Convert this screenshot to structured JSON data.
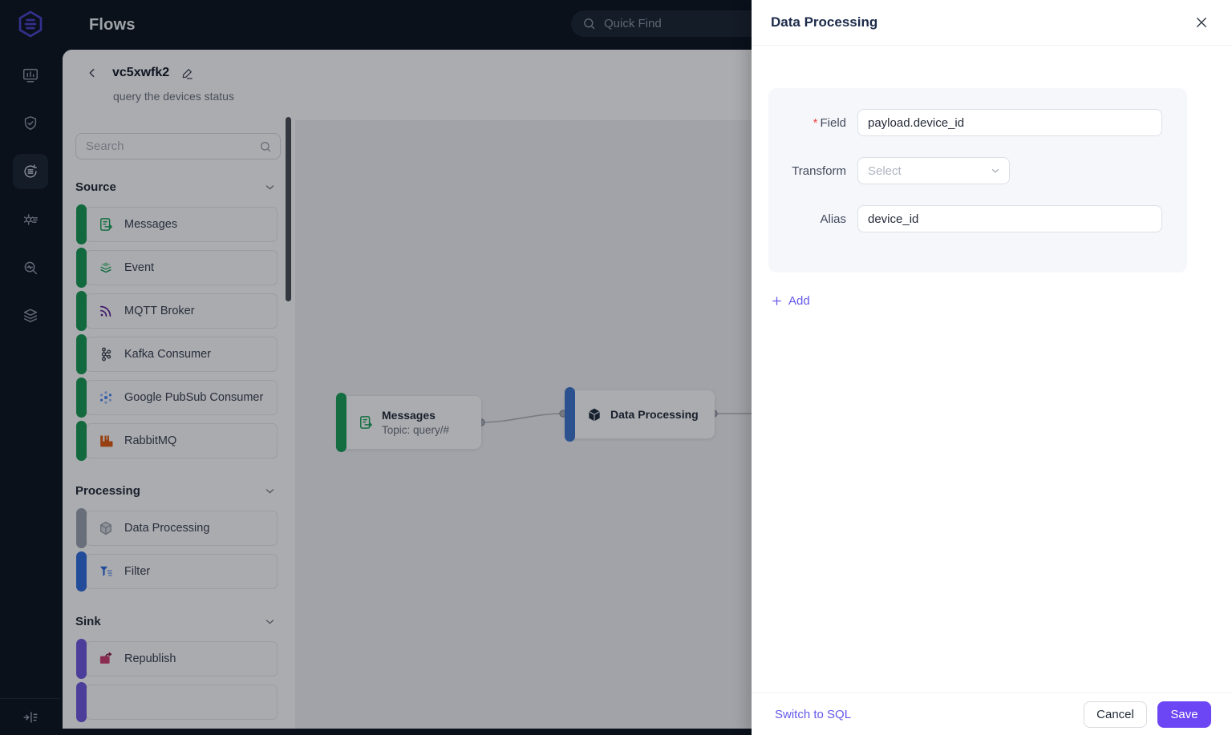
{
  "topbar": {
    "title": "Flows",
    "quick_find_placeholder": "Quick Find"
  },
  "sidebar": {
    "logo_icon": "hexagon-list-logo",
    "icons": [
      "dashboard-icon",
      "shield-check-icon",
      "flows-icon",
      "rule-engine-icon",
      "monitor-search-icon",
      "layers-icon"
    ],
    "active_icon": "flows-icon",
    "footer_icon": "expand-sidebar-icon"
  },
  "flow": {
    "name": "vc5xwfk2",
    "description": "query the devices status"
  },
  "palette": {
    "search_placeholder": "Search",
    "sections": [
      {
        "label": "Source",
        "items": [
          {
            "label": "Messages",
            "icon": "message-doc-icon",
            "accent": "#179a53"
          },
          {
            "label": "Event",
            "icon": "event-layers-icon",
            "accent": "#179a53"
          },
          {
            "label": "MQTT Broker",
            "icon": "mqtt-signal-icon",
            "accent": "#179a53"
          },
          {
            "label": "Kafka Consumer",
            "icon": "kafka-icon",
            "accent": "#179a53"
          },
          {
            "label": "Google PubSub Consumer",
            "icon": "google-pubsub-icon",
            "accent": "#179a53"
          },
          {
            "label": "RabbitMQ",
            "icon": "rabbitmq-icon",
            "accent": "#179a53"
          }
        ]
      },
      {
        "label": "Processing",
        "items": [
          {
            "label": "Data Processing",
            "icon": "cube-icon",
            "accent": "#9ca3af"
          },
          {
            "label": "Filter",
            "icon": "filter-funnel-icon",
            "accent": "#2f6ee0"
          }
        ]
      },
      {
        "label": "Sink",
        "items": [
          {
            "label": "Republish",
            "icon": "republish-icon",
            "accent": "#7057e0"
          },
          {
            "label": "",
            "icon": "",
            "accent": "#7057e0"
          }
        ]
      }
    ]
  },
  "canvas": {
    "nodes": [
      {
        "title": "Messages",
        "subtitle": "Topic: query/#",
        "icon": "message-doc-icon",
        "accent": "#1a9e58"
      },
      {
        "title": "Data Processing",
        "icon": "cube-icon",
        "accent": "#3d76cf"
      }
    ],
    "edge_color": "#b4b5bb"
  },
  "drawer": {
    "title": "Data Processing",
    "close_icon": "close-icon",
    "form": {
      "fields": [
        {
          "label": "Field",
          "required": true,
          "type": "input",
          "value": "payload.device_id"
        },
        {
          "label": "Transform",
          "required": false,
          "type": "select",
          "placeholder": "Select"
        },
        {
          "label": "Alias",
          "required": false,
          "type": "input",
          "value": "device_id"
        }
      ]
    },
    "add_label": "Add",
    "footer": {
      "switch_label": "Switch to SQL",
      "cancel_label": "Cancel",
      "save_label": "Save"
    }
  },
  "colors": {
    "accent_purple": "#6c45f4",
    "link_purple": "#6358e8",
    "source_green": "#179a53",
    "processing_gray": "#9ca3af",
    "filter_blue": "#2f6ee0",
    "sink_purple": "#7057e0",
    "node_blue": "#3d76cf",
    "sidebar_bg": "#0c141f",
    "canvas_bg": "#f0f1f4"
  }
}
